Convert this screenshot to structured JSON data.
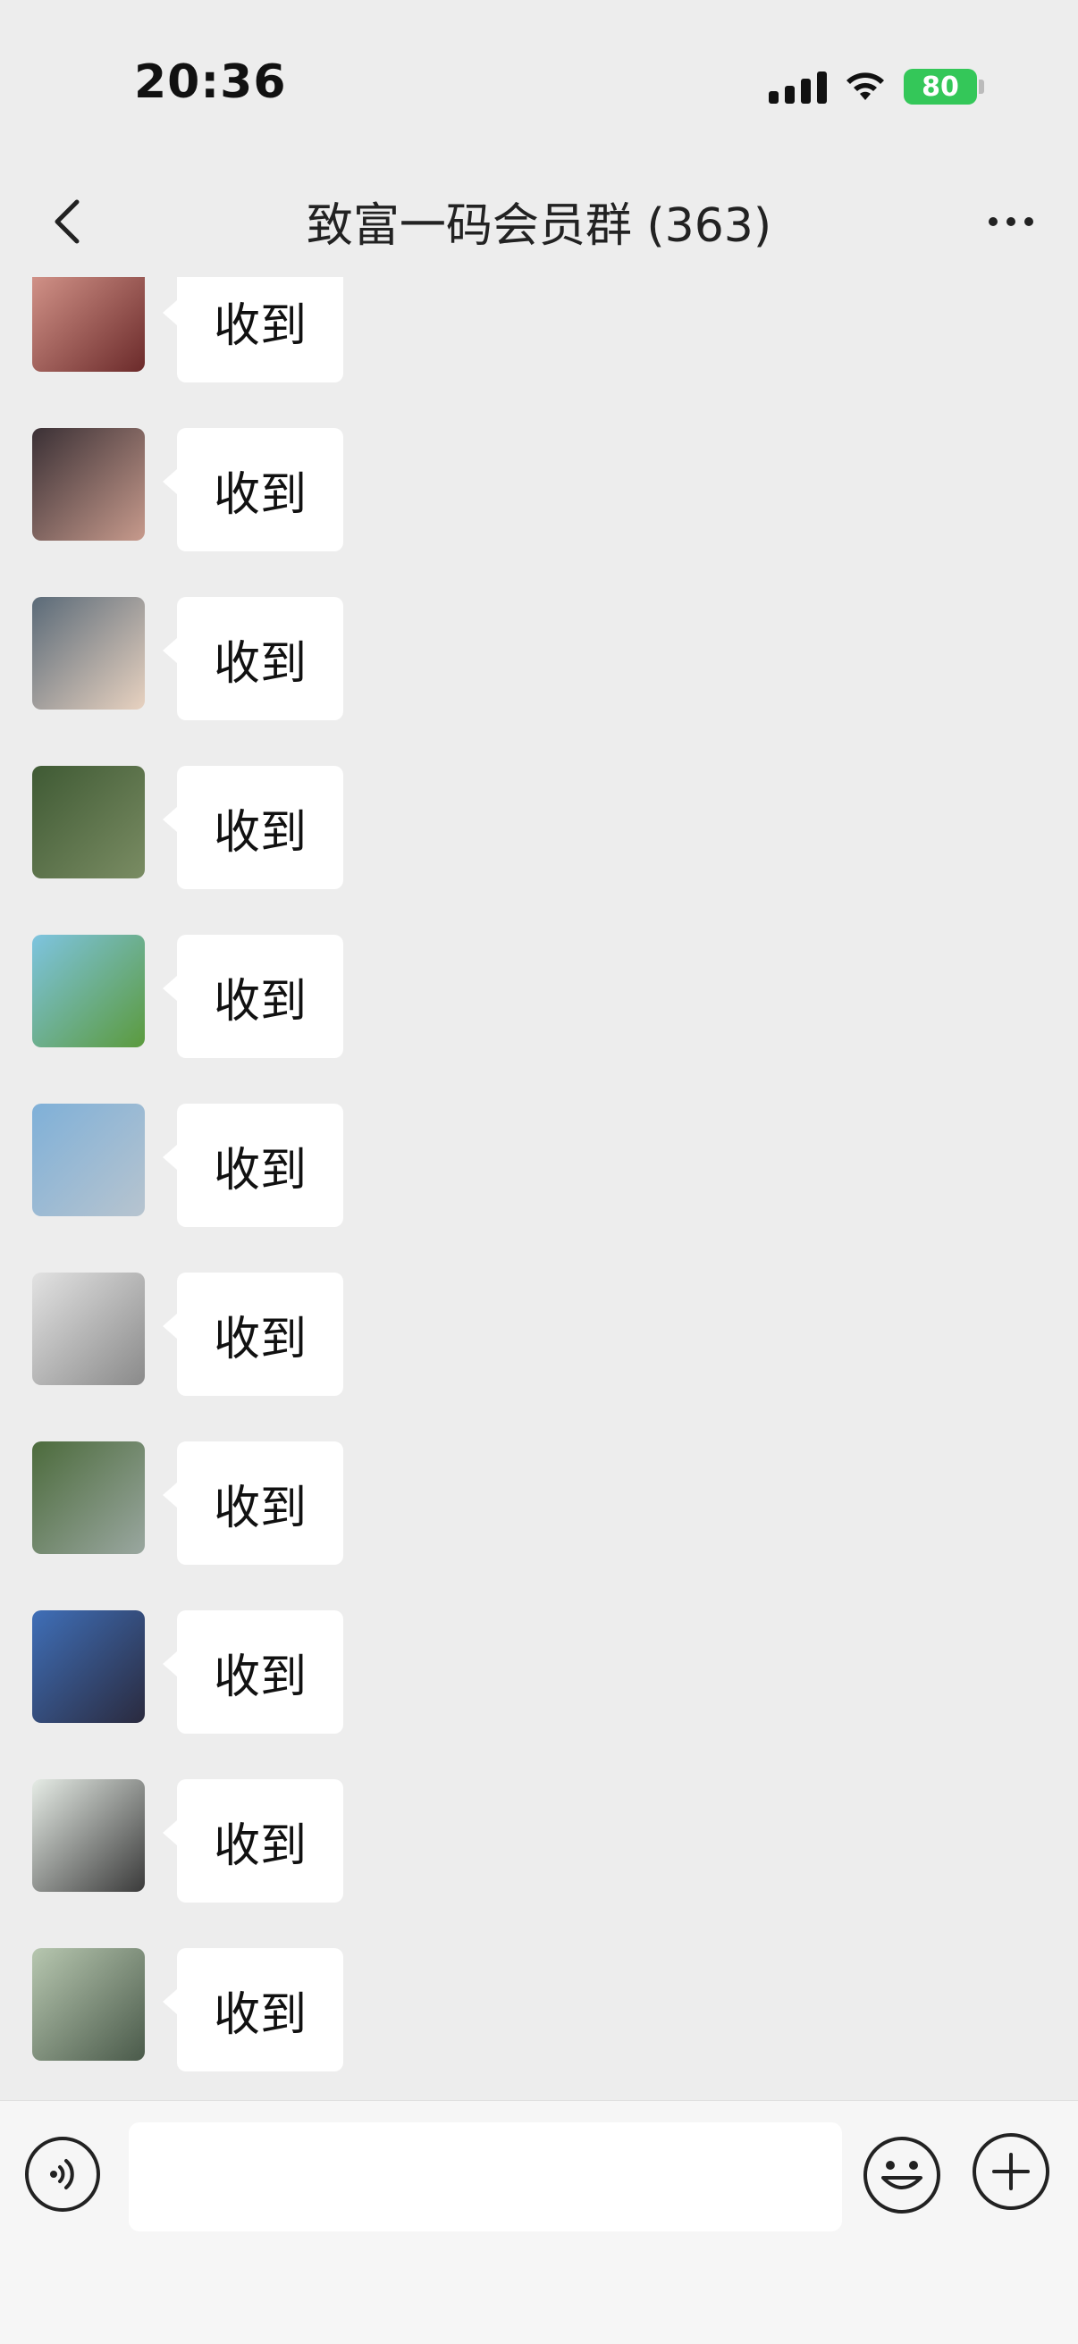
{
  "status_bar": {
    "time": "20:36",
    "battery": "80",
    "icons": [
      "cellular-signal-icon",
      "wifi-icon",
      "battery-charging-icon"
    ]
  },
  "nav": {
    "title": "致富一码会员群 (363)",
    "back_icon": "chevron-left-icon",
    "more_icon": "more-dots-icon"
  },
  "messages": [
    {
      "text": "收到",
      "avatar_colors": [
        "#d99a8f",
        "#6b2a2a"
      ]
    },
    {
      "text": "收到",
      "avatar_colors": [
        "#3a3035",
        "#c79a8c"
      ]
    },
    {
      "text": "收到",
      "avatar_colors": [
        "#5a6a78",
        "#e8d2c0"
      ]
    },
    {
      "text": "收到",
      "avatar_colors": [
        "#3f5a34",
        "#7a8c63"
      ]
    },
    {
      "text": "收到",
      "avatar_colors": [
        "#7ec4e0",
        "#5b9a3d"
      ]
    },
    {
      "text": "收到",
      "avatar_colors": [
        "#7fb0d8",
        "#b7c4cf"
      ]
    },
    {
      "text": "收到",
      "avatar_colors": [
        "#e2e2e2",
        "#8a8a8a"
      ]
    },
    {
      "text": "收到",
      "avatar_colors": [
        "#4c6b3c",
        "#9aa7a0"
      ]
    },
    {
      "text": "收到",
      "avatar_colors": [
        "#3f6fb8",
        "#2a2a3e"
      ]
    },
    {
      "text": "收到",
      "avatar_colors": [
        "#e6ece6",
        "#3a3a3a"
      ]
    },
    {
      "text": "收到",
      "avatar_colors": [
        "#b7c7b0",
        "#4a5a4a"
      ]
    }
  ],
  "input_bar": {
    "voice_icon": "voice-icon",
    "emoji_icon": "emoji-icon",
    "plus_icon": "plus-icon",
    "input_value": ""
  }
}
